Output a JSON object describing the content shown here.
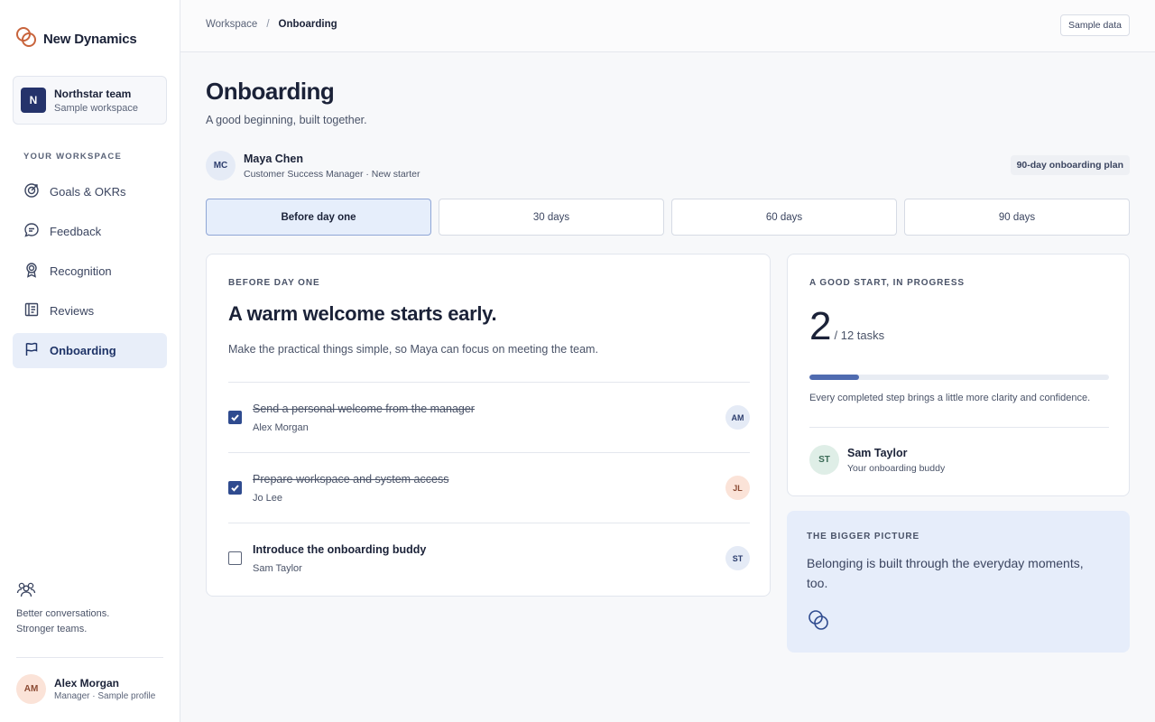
{
  "brand": {
    "name": "New Dynamics",
    "logo_icon": "linked-rings-icon",
    "accent": "#c8643c"
  },
  "team": {
    "initial": "N",
    "name": "Northstar team",
    "subtitle": "Sample workspace"
  },
  "sidebar": {
    "heading": "YOUR WORKSPACE",
    "items": [
      {
        "label": "Goals & OKRs",
        "icon": "target-icon"
      },
      {
        "label": "Feedback",
        "icon": "chat-bubble-icon"
      },
      {
        "label": "Recognition",
        "icon": "award-badge-icon"
      },
      {
        "label": "Reviews",
        "icon": "document-list-icon"
      },
      {
        "label": "Onboarding",
        "icon": "flag-icon",
        "active": true
      }
    ],
    "tagline_line1": "Better conversations.",
    "tagline_line2": "Stronger teams.",
    "footer_icon": "people-group-icon"
  },
  "user": {
    "initials": "AM",
    "name": "Alex Morgan",
    "role": "Manager · Sample profile"
  },
  "topbar": {
    "breadcrumb": [
      "Workspace",
      "Onboarding"
    ],
    "separator": "/",
    "sample_button": "Sample data"
  },
  "page": {
    "title": "Onboarding",
    "subtitle": "A good beginning, built together."
  },
  "newstarter": {
    "initials": "MC",
    "name": "Maya Chen",
    "role": "Customer Success Manager · New starter",
    "plan_badge": "90-day onboarding plan"
  },
  "tabs": [
    {
      "label": "Before day one",
      "active": true
    },
    {
      "label": "30 days"
    },
    {
      "label": "60 days"
    },
    {
      "label": "90 days"
    }
  ],
  "phase_card": {
    "eyebrow": "BEFORE DAY ONE",
    "heading": "A warm welcome starts early.",
    "description": "Make the practical things simple, so Maya can focus on meeting the team.",
    "tasks": [
      {
        "title": "Send a personal welcome from the manager",
        "owner": "Alex Morgan",
        "initials": "AM",
        "done": true,
        "avatar_bg": "#e5ebf6",
        "avatar_fg": "#2d3e6e"
      },
      {
        "title": "Prepare workspace and system access",
        "owner": "Jo Lee",
        "initials": "JL",
        "done": true,
        "avatar_bg": "#fbe3d8",
        "avatar_fg": "#8b4a33"
      },
      {
        "title": "Introduce the onboarding buddy",
        "owner": "Sam Taylor",
        "initials": "ST",
        "done": false,
        "avatar_bg": "#e5ebf6",
        "avatar_fg": "#2d3e6e"
      }
    ]
  },
  "progress_card": {
    "eyebrow": "A GOOD START, IN PROGRESS",
    "completed": "2",
    "total_label": "/ 12 tasks",
    "fraction": 0.1667,
    "note": "Every completed step brings a little more clarity and confidence.",
    "buddy": {
      "initials": "ST",
      "name": "Sam Taylor",
      "role": "Your onboarding buddy"
    }
  },
  "picture_card": {
    "eyebrow": "THE BIGGER PICTURE",
    "text": "Belonging is built through the everyday moments, too.",
    "icon": "linked-rings-icon"
  }
}
